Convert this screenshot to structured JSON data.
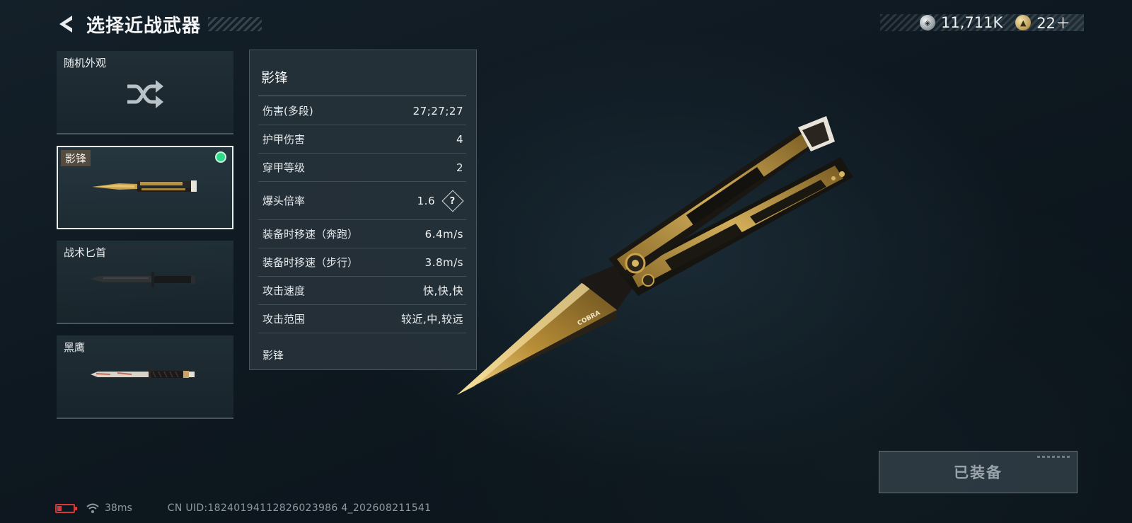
{
  "header": {
    "title": "选择近战武器"
  },
  "currency": [
    {
      "icon": "silver-coin-icon",
      "value": "11,711K"
    },
    {
      "icon": "gold-coin-icon",
      "value": "22＋"
    }
  ],
  "weapons": [
    {
      "label": "随机外观",
      "icon": "shuffle-icon",
      "selected": false
    },
    {
      "label": "影锋",
      "icon": "butterfly-knife-icon",
      "selected": true,
      "equipped": true
    },
    {
      "label": "战术匕首",
      "icon": "tactical-dagger-icon",
      "selected": false
    },
    {
      "label": "黑鹰",
      "icon": "black-hawk-knife-icon",
      "selected": false
    }
  ],
  "panel": {
    "title": "影锋",
    "stats": [
      {
        "label": "伤害(多段)",
        "value": "27;27;27"
      },
      {
        "label": "护甲伤害",
        "value": "4"
      },
      {
        "label": "穿甲等级",
        "value": "2"
      },
      {
        "label": "爆头倍率",
        "value": "1.6",
        "help": "?"
      },
      {
        "label": "装备时移速（奔跑）",
        "value": "6.4m/s"
      },
      {
        "label": "装备时移速（步行）",
        "value": "3.8m/s"
      },
      {
        "label": "攻击速度",
        "value": "快,快,快"
      },
      {
        "label": "攻击范围",
        "value": "较近,中,较远"
      }
    ],
    "footer": "影锋"
  },
  "equip_button": {
    "label": "已装备"
  },
  "footer": {
    "ping": "38ms",
    "uid": "CN UID:18240194112826023986 4_202608211541"
  },
  "colors": {
    "equipped_dot": "#2fd98a",
    "battery_low": "#d43a3a",
    "gold": "#c9a24a"
  }
}
